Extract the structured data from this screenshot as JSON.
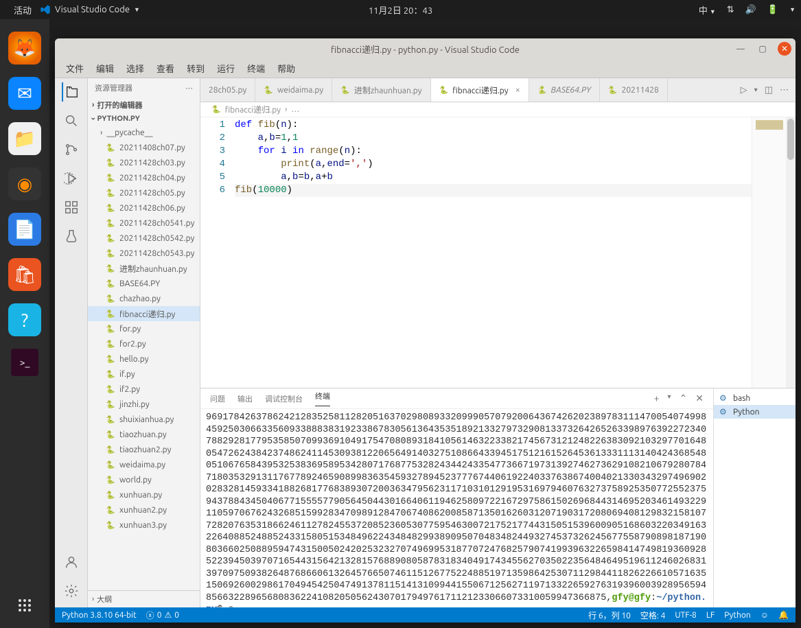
{
  "ubuntu": {
    "activities": "活动",
    "app_name": "Visual Studio Code",
    "datetime": "11月2日 20：43",
    "lang": "中"
  },
  "window": {
    "title": "fibnacci递归.py - python.py - Visual Studio Code"
  },
  "menu": [
    "文件",
    "编辑",
    "选择",
    "查看",
    "转到",
    "运行",
    "终端",
    "帮助"
  ],
  "sidebar": {
    "title": "资源管理器",
    "open_editors": "打开的编辑器",
    "project": "PYTHON.PY",
    "pycache": "__pycache__",
    "files": [
      "20211408ch07.py",
      "20211428ch03.py",
      "20211428ch04.py",
      "20211428ch05.py",
      "20211428ch06.py",
      "20211428ch0541.py",
      "20211428ch0542.py",
      "20211428ch0543.py",
      "进制zhaunhuan.py",
      "BASE64.PY",
      "chazhao.py",
      "fibnacci递归.py",
      "for.py",
      "for2.py",
      "hello.py",
      "if.py",
      "if2.py",
      "jinzhi.py",
      "shuixianhua.py",
      "tiaozhuan.py",
      "tiaozhuan2.py",
      "weidaima.py",
      "world.py",
      "xunhuan.py",
      "xunhuan2.py",
      "xunhuan3.py"
    ],
    "active_file": "fibnacci递归.py",
    "outline": "大纲"
  },
  "tabs": [
    {
      "label": "28ch05.py",
      "active": false,
      "italic": false,
      "icon": false
    },
    {
      "label": "weidaima.py",
      "active": false,
      "italic": false,
      "icon": true
    },
    {
      "label": "进制zhaunhuan.py",
      "active": false,
      "italic": false,
      "icon": true
    },
    {
      "label": "fibnacci递归.py",
      "active": true,
      "italic": false,
      "icon": true
    },
    {
      "label": "BASE64.PY",
      "active": false,
      "italic": true,
      "icon": true
    },
    {
      "label": "20211428",
      "active": false,
      "italic": false,
      "icon": true
    }
  ],
  "breadcrumb": {
    "file": "fibnacci递归.py",
    "more": "…"
  },
  "code": {
    "lines": [
      {
        "n": "1",
        "tokens": [
          [
            "kw",
            "def "
          ],
          [
            "fn",
            "fib"
          ],
          [
            "op",
            "("
          ],
          [
            "id",
            "n"
          ],
          [
            "op",
            ")"
          ],
          [
            "op",
            ":"
          ]
        ]
      },
      {
        "n": "2",
        "tokens": [
          [
            "op",
            "    "
          ],
          [
            "id",
            "a"
          ],
          [
            "op",
            ","
          ],
          [
            "id",
            "b"
          ],
          [
            "op",
            "="
          ],
          [
            "num",
            "1"
          ],
          [
            "op",
            ","
          ],
          [
            "num",
            "1"
          ]
        ]
      },
      {
        "n": "3",
        "tokens": [
          [
            "op",
            "    "
          ],
          [
            "kw",
            "for"
          ],
          [
            "op",
            " "
          ],
          [
            "id",
            "i"
          ],
          [
            "op",
            " "
          ],
          [
            "kw",
            "in"
          ],
          [
            "op",
            " "
          ],
          [
            "fn",
            "range"
          ],
          [
            "op",
            "("
          ],
          [
            "id",
            "n"
          ],
          [
            "op",
            ")"
          ],
          [
            "op",
            ":"
          ]
        ]
      },
      {
        "n": "4",
        "tokens": [
          [
            "op",
            "        "
          ],
          [
            "fn",
            "print"
          ],
          [
            "op",
            "("
          ],
          [
            "id",
            "a"
          ],
          [
            "op",
            ","
          ],
          [
            "id",
            "end"
          ],
          [
            "op",
            "="
          ],
          [
            "str",
            "','"
          ],
          [
            "op",
            ")"
          ]
        ]
      },
      {
        "n": "5",
        "tokens": [
          [
            "op",
            "        "
          ],
          [
            "id",
            "a"
          ],
          [
            "op",
            ","
          ],
          [
            "id",
            "b"
          ],
          [
            "op",
            "="
          ],
          [
            "id",
            "b"
          ],
          [
            "op",
            ","
          ],
          [
            "id",
            "a"
          ],
          [
            "op",
            "+"
          ],
          [
            "id",
            "b"
          ]
        ]
      },
      {
        "n": "6",
        "tokens": [
          [
            "fn",
            "fib"
          ],
          [
            "op",
            "("
          ],
          [
            "num",
            "10000"
          ],
          [
            "op",
            ")"
          ]
        ],
        "current": true
      }
    ]
  },
  "panel": {
    "tabs": {
      "problems": "问题",
      "output": "输出",
      "debug": "调试控制台",
      "terminal": "终端"
    },
    "side": [
      {
        "label": "bash",
        "active": false
      },
      {
        "label": "Python",
        "active": true
      }
    ],
    "terminal_body": "969178426378624212835258112820516370298089332099905707920064367426202389783111470054074998459250306633560933888383192338678305613643535189213327973290813373264265263398976392272340788292817795358507099369104917547080893184105614632233821745673121248226383092103297701648054726243842374862411453093812206564914032751086643394517512161526453613331113140424368548051067658439532538369589534280717687753282434424335477366719731392746273629108210679280784718035329131176778924659089983635459327894523777674406192240337638674004021330343297496902028328145933418826817768389307200363479562311710310129195316979460763273758925350772552375943788434504067715555779056450443016640611946258097221672975861502696844314695203461493229110597067624326851599283470989128470674086200858713501626031207190317208069408129832158107728207635318662461127824553720852360530775954630072175217744315051539600905168603220349163226408852488524331580515348496224348482993890950704834824493274537326245677558790898187190803660250889594743150050242025323270749699531877072476825790741993963226598414749819360928522394503970716544315642132815768890805878318340491743455627035022356484649519611246026831397097509382648768660613264576650746115126775224885197135986425307112984411826226610571635150692600298617049454250474913781151413109944155067125627119713322659276319396003928956594856632289656808362241082050562430701794976171121233066073310059947366875,",
    "prompt_user": "gfy@gfy",
    "prompt_path": "~/python.py",
    "prompt_suffix": "$ "
  },
  "status": {
    "python": "Python 3.8.10 64-bit",
    "errors": "0",
    "warnings": "0",
    "pos": "行 6，列 10",
    "spaces": "空格: 4",
    "encoding": "UTF-8",
    "eol": "LF",
    "lang": "Python"
  }
}
